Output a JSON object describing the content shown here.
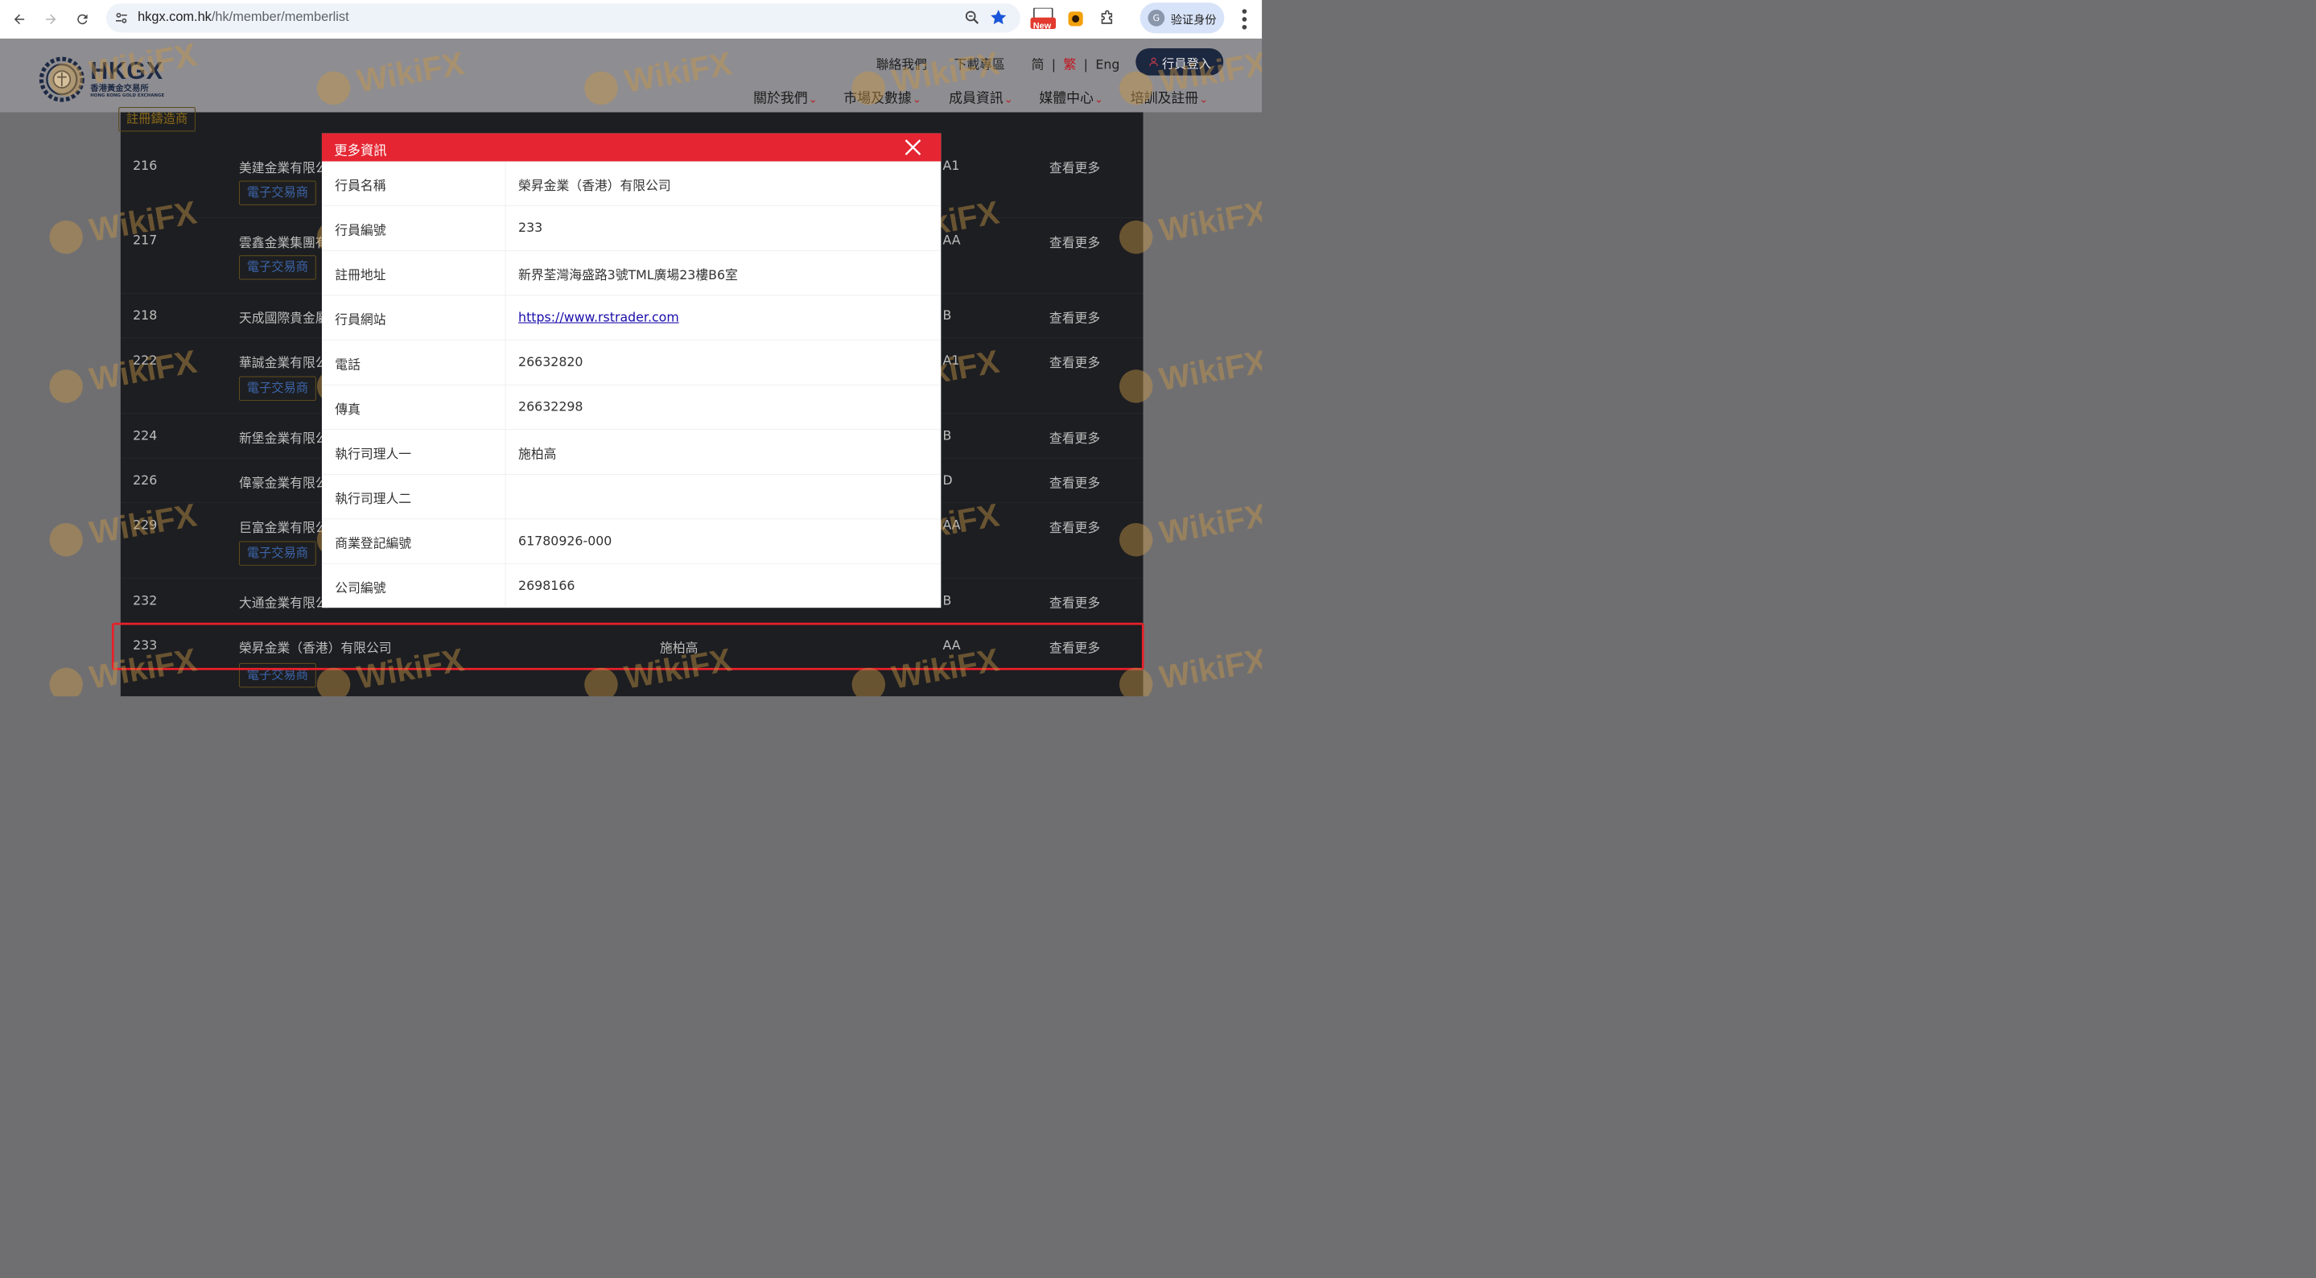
{
  "browser": {
    "url_host": "hkgx.com.hk",
    "url_path": "/hk/member/memberlist",
    "ext_new_label": "New",
    "verify_label": "验证身份",
    "verify_initial": "G"
  },
  "site": {
    "logo_text": "HKGX",
    "logo_cn": "香港黃金交易所",
    "logo_en": "HONG KONG GOLD EXCHANGE",
    "top_links": [
      "聯絡我們",
      "下載專區"
    ],
    "lang_sc": "简",
    "lang_tc": "繁",
    "lang_en": "Eng",
    "lang_sep": "|",
    "login_label": "行員登入",
    "nav": [
      "關於我們",
      "市場及數據",
      "成員資訊",
      "媒體中心",
      "培訓及註冊"
    ],
    "accent_color": "#e52632"
  },
  "table": {
    "top_tag": "註冊鑄造商",
    "more_label": "查看更多",
    "rows": [
      {
        "idx": "216",
        "name": "美建金業有限公",
        "grade": "A1",
        "tag": "電子交易商"
      },
      {
        "idx": "217",
        "name": "雲鑫金業集團有",
        "grade": "AA",
        "tag": "電子交易商"
      },
      {
        "idx": "218",
        "name": "天成國際貴金屬",
        "grade": "B",
        "tag": ""
      },
      {
        "idx": "222",
        "name": "華誠金業有限公",
        "grade": "A1",
        "tag": "電子交易商"
      },
      {
        "idx": "224",
        "name": "新堡金業有限公",
        "grade": "B",
        "tag": ""
      },
      {
        "idx": "226",
        "name": "偉豪金業有限公",
        "grade": "D",
        "tag": ""
      },
      {
        "idx": "229",
        "name": "巨富金業有限公",
        "grade": "AA",
        "tag": "電子交易商"
      },
      {
        "idx": "232",
        "name": "大通金業有限公",
        "grade": "B",
        "tag": ""
      },
      {
        "idx": "233",
        "name": "榮昇金業（香港）有限公司",
        "director": "施柏高",
        "grade": "AA",
        "tag": "電子交易商"
      }
    ]
  },
  "modal": {
    "title": "更多資訊",
    "rows": [
      {
        "label": "行員名稱",
        "value": "榮昇金業（香港）有限公司"
      },
      {
        "label": "行員編號",
        "value": "233"
      },
      {
        "label": "註冊地址",
        "value": "新界荃灣海盛路3號TML廣場23樓B6室"
      },
      {
        "label": "行員網站",
        "value": "https://www.rstrader.com"
      },
      {
        "label": "電話",
        "value": "26632820"
      },
      {
        "label": "傳真",
        "value": "26632298"
      },
      {
        "label": "執行司理人一",
        "value": "施柏高"
      },
      {
        "label": "執行司理人二",
        "value": ""
      },
      {
        "label": "商業登記編號",
        "value": "61780926-000"
      },
      {
        "label": "公司編號",
        "value": "2698166"
      }
    ]
  },
  "watermark": "WikiFX"
}
